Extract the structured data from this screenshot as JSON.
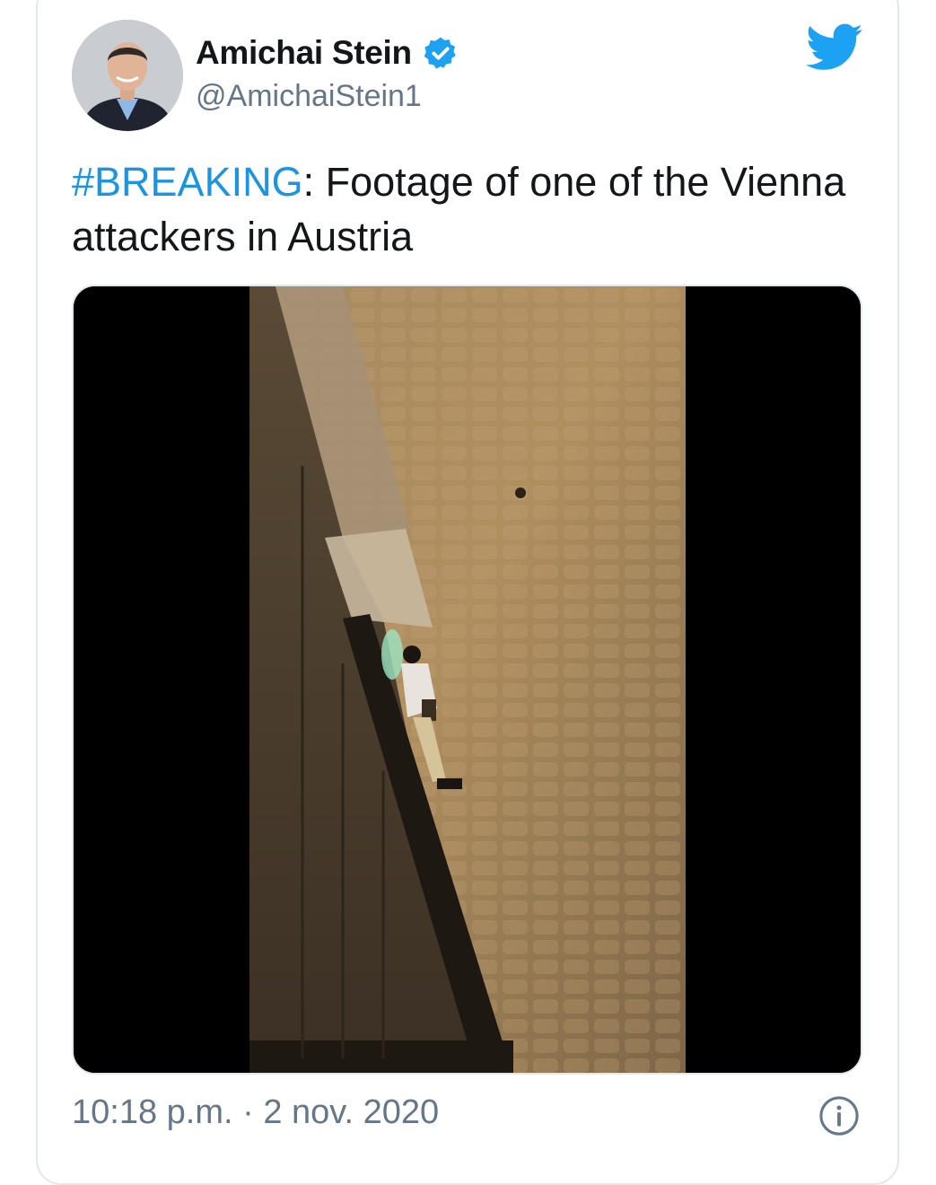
{
  "author": {
    "name": "Amichai Stein",
    "handle": "@AmichaiStein1",
    "verified": true
  },
  "tweet": {
    "hashtag": "#BREAKING",
    "text": ": Footage of one of the Vienna attackers in Austria"
  },
  "footer": {
    "timestamp": "10:18 p.m. · 2 nov. 2020"
  },
  "colors": {
    "brand": "#1da1f2",
    "hashtag": "#1b95e0",
    "muted": "#657786",
    "text": "#14171a"
  },
  "icons": {
    "logo": "twitter-bird-icon",
    "verified": "verified-badge-icon",
    "info": "info-icon"
  }
}
